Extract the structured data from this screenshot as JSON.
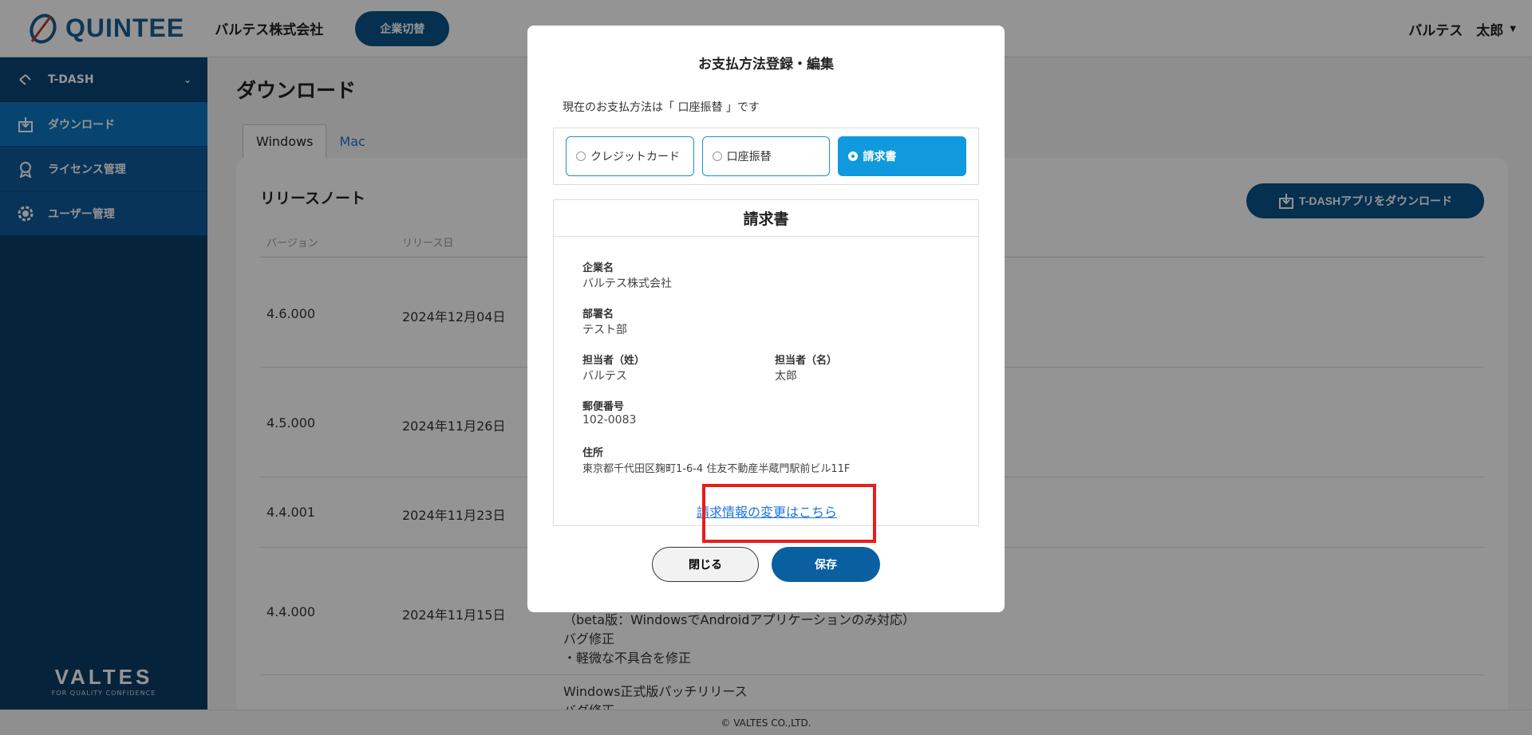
{
  "header": {
    "logo_text": "QUINTEE",
    "company": "バルテス株式会社",
    "switch_label": "企業切替",
    "user_name": "バルテス　太郎"
  },
  "sidebar": {
    "group": "T-DASH",
    "items": [
      {
        "label": "ダウンロード",
        "icon": "download-icon"
      },
      {
        "label": "ライセンス管理",
        "icon": "license-badge-icon"
      },
      {
        "label": "ユーザー管理",
        "icon": "gear-icon"
      }
    ],
    "brand": "VALTES",
    "brand_tagline": "FOR QUALITY CONFIDENCE"
  },
  "main": {
    "title": "ダウンロード",
    "tabs": [
      "Windows",
      "Mac"
    ],
    "card_title": "リリースノート",
    "download_button": "T-DASHアプリをダウンロード",
    "columns": [
      "バージョン",
      "リリース日"
    ],
    "releases": [
      {
        "version": "4.6.000",
        "date": "2024年12月04日"
      },
      {
        "version": "4.5.000",
        "date": "2024年11月26日"
      },
      {
        "version": "4.4.001",
        "date": "2024年11月23日"
      },
      {
        "version": "4.4.000",
        "date": "2024年11月15日"
      }
    ],
    "notes_440": [
      "（beta版：WindowsでAndroidアプリケーションのみ対応）",
      "バグ修正",
      "・軽微な不具合を修正"
    ],
    "notes_next": [
      "Windows正式版パッチリリース",
      "バグ修正"
    ]
  },
  "footer": {
    "copyright": "© VALTES CO.,LTD."
  },
  "modal": {
    "title": "お支払方法登録・編集",
    "current": "現在のお支払方法は「 口座振替 」です",
    "methods": [
      "クレジットカード",
      "口座振替",
      "請求書"
    ],
    "selected": "請求書",
    "invoice_title": "請求書",
    "fields": {
      "company_label": "企業名",
      "company_value": "バルテス株式会社",
      "dept_label": "部署名",
      "dept_value": "テスト部",
      "last_label": "担当者（姓）",
      "last_value": "バルテス",
      "first_label": "担当者（名）",
      "first_value": "太郎",
      "zip_label": "郵便番号",
      "zip_value": "102-0083",
      "addr_label": "住所",
      "addr_value": "東京都千代田区麹町1-6-4 住友不動産半蔵門駅前ビル11F"
    },
    "change_link": "請求情報の変更はこちら",
    "close_label": "閉じる",
    "save_label": "保存",
    "highlight_color": "#e81c1c"
  }
}
